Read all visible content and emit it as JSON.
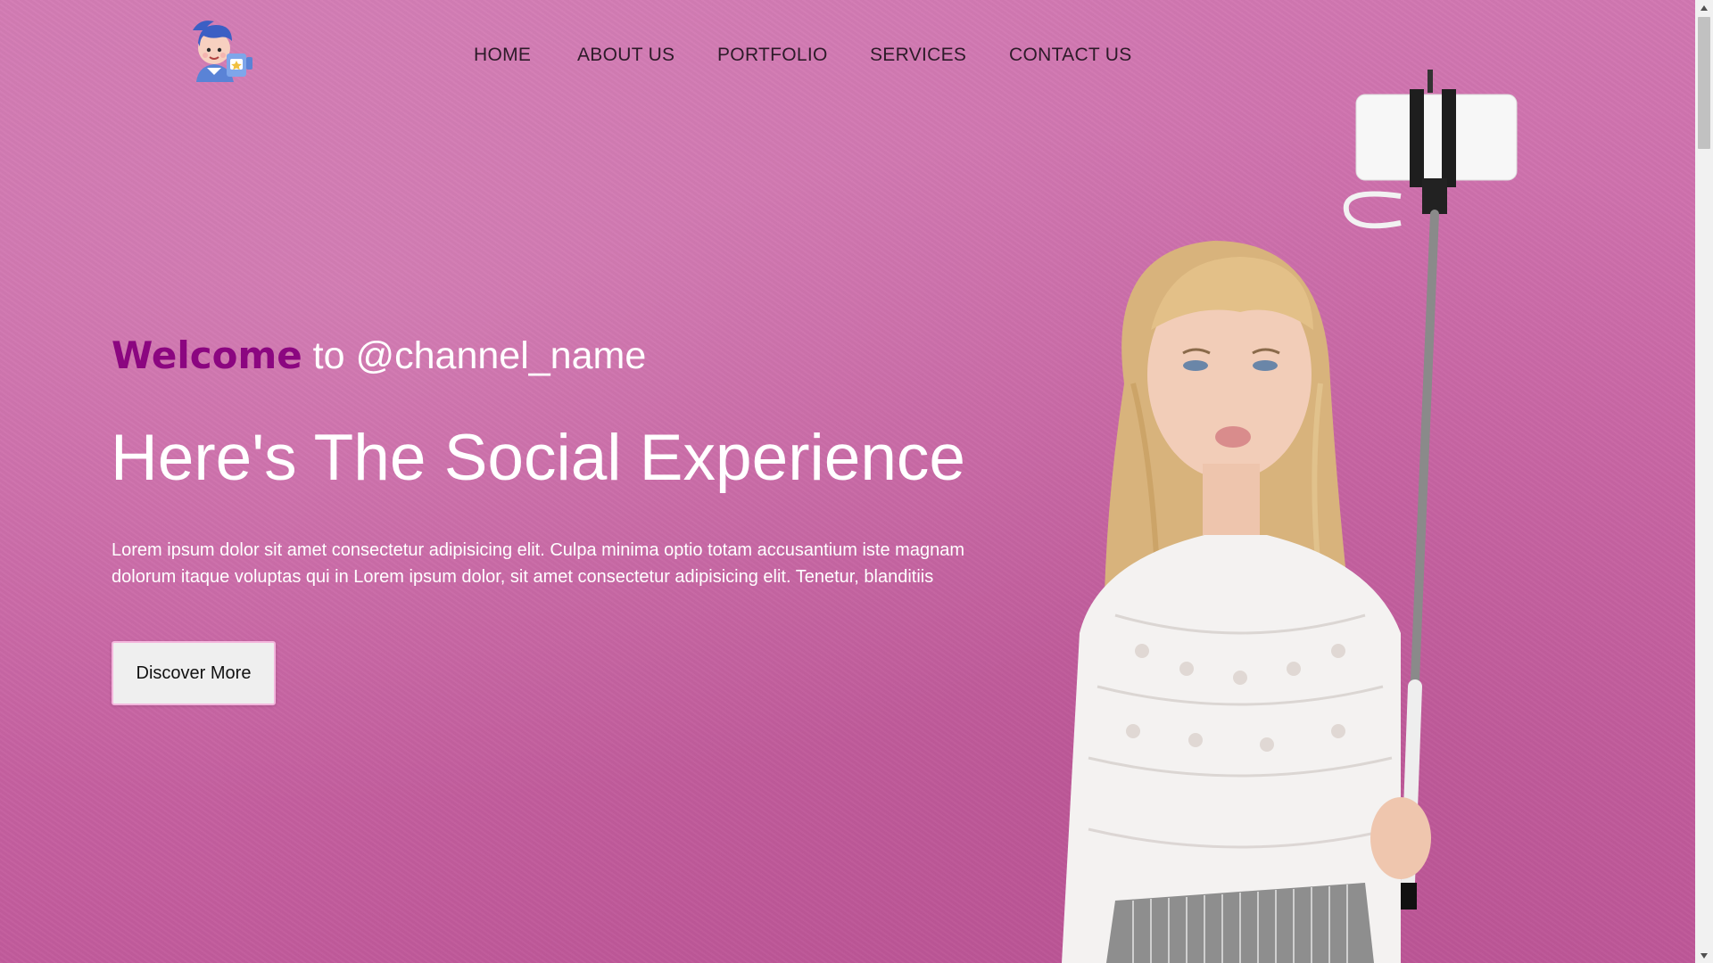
{
  "nav": {
    "items": [
      {
        "label": "HOME"
      },
      {
        "label": "ABOUT US"
      },
      {
        "label": "PORTFOLIO"
      },
      {
        "label": "SERVICES"
      },
      {
        "label": "CONTACT US"
      }
    ]
  },
  "hero": {
    "welcome_accent": "Welcome",
    "welcome_rest": "to @channel_name",
    "headline": "Here's The Social Experience",
    "paragraph": "Lorem ipsum dolor sit amet consectetur adipisicing elit. Culpa minima optio totam accusantium iste magnam dolorum itaque voluptas qui in Lorem ipsum dolor, sit amet consectetur adipisicing elit. Tenetur, blanditiis",
    "cta_label": "Discover More"
  },
  "colors": {
    "background": "#c9609f",
    "welcome_accent": "#8b0680",
    "nav_text": "#2d1b29",
    "button_bg": "#efefef",
    "button_border": "#f4b6dd"
  },
  "icons": {
    "logo": "cartoon-user-with-camera-icon",
    "scroll_up": "triangle-up-icon",
    "scroll_down": "triangle-down-icon"
  }
}
